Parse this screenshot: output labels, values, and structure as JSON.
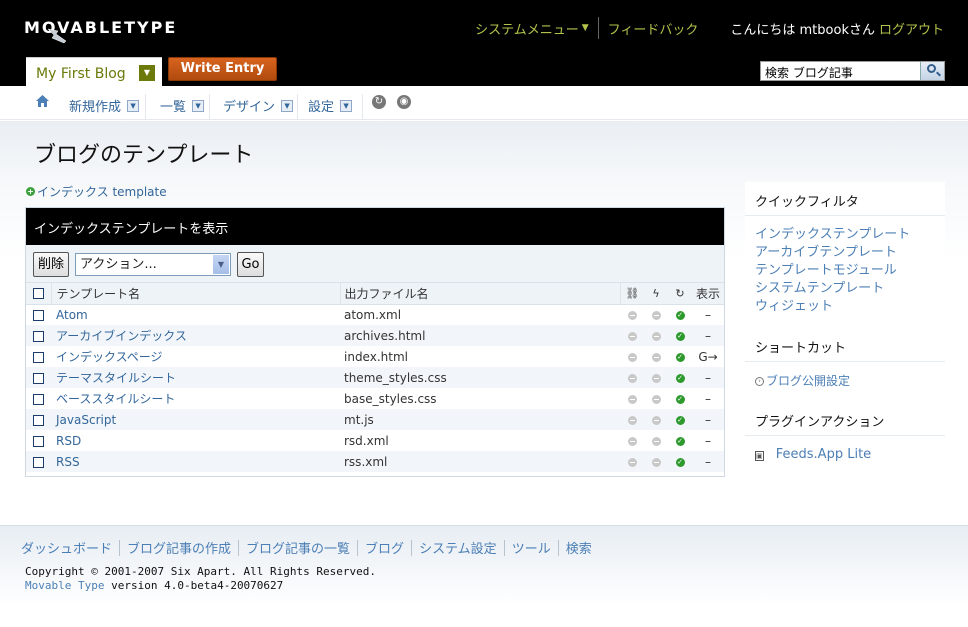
{
  "header": {
    "logo": "MOVABLETYPE",
    "system_menu": "システムメニュー",
    "feedback": "フィードバック",
    "greeting": "こんにちは mtbookさん",
    "logout": "ログアウト",
    "blog_name": "My First Blog",
    "write_entry": "Write Entry",
    "search_value": "検索 ブログ記事"
  },
  "menu": {
    "items": [
      "新規作成",
      "一覧",
      "デザイン",
      "設定"
    ]
  },
  "page": {
    "title": "ブログのテンプレート",
    "create_link": "インデックス template"
  },
  "listing": {
    "header": "インデックステンプレートを表示",
    "delete_button": "削除",
    "action_select": "アクション...",
    "go_button": "Go",
    "columns": [
      "テンプレート名",
      "出力ファイル名",
      "表示"
    ],
    "rows": [
      {
        "name": "Atom",
        "output": "atom.xml",
        "view": "–"
      },
      {
        "name": "アーカイブインデックス",
        "output": "archives.html",
        "view": "–"
      },
      {
        "name": "インデックスページ",
        "output": "index.html",
        "view": "G→"
      },
      {
        "name": "テーマスタイルシート",
        "output": "theme_styles.css",
        "view": "–"
      },
      {
        "name": "ベーススタイルシート",
        "output": "base_styles.css",
        "view": "–"
      },
      {
        "name": "JavaScript",
        "output": "mt.js",
        "view": "–"
      },
      {
        "name": "RSD",
        "output": "rsd.xml",
        "view": "–"
      },
      {
        "name": "RSS",
        "output": "rss.xml",
        "view": "–"
      }
    ]
  },
  "sidebar": {
    "quick_filter_title": "クイックフィルタ",
    "quick_filters": [
      "インデックステンプレート",
      "アーカイブテンプレート",
      "テンプレートモジュール",
      "システムテンプレート",
      "ウィジェット"
    ],
    "shortcut_title": "ショートカット",
    "shortcut": "ブログ公開設定",
    "plugin_title": "プラグインアクション",
    "plugin": "Feeds.App Lite"
  },
  "footer": {
    "links": [
      "ダッシュボード",
      "ブログ記事の作成",
      "ブログ記事の一覧",
      "ブログ",
      "システム設定",
      "ツール",
      "検索"
    ],
    "copyright": "Copyright © 2001-2007 Six Apart. All Rights Reserved.",
    "product": "Movable Type",
    "version": "version 4.0-beta4-20070627"
  },
  "colors": {
    "header_bg": "#000000",
    "accent_green": "#b4c24a",
    "link_blue": "#33669a",
    "write_entry_orange": "#c9561a"
  }
}
